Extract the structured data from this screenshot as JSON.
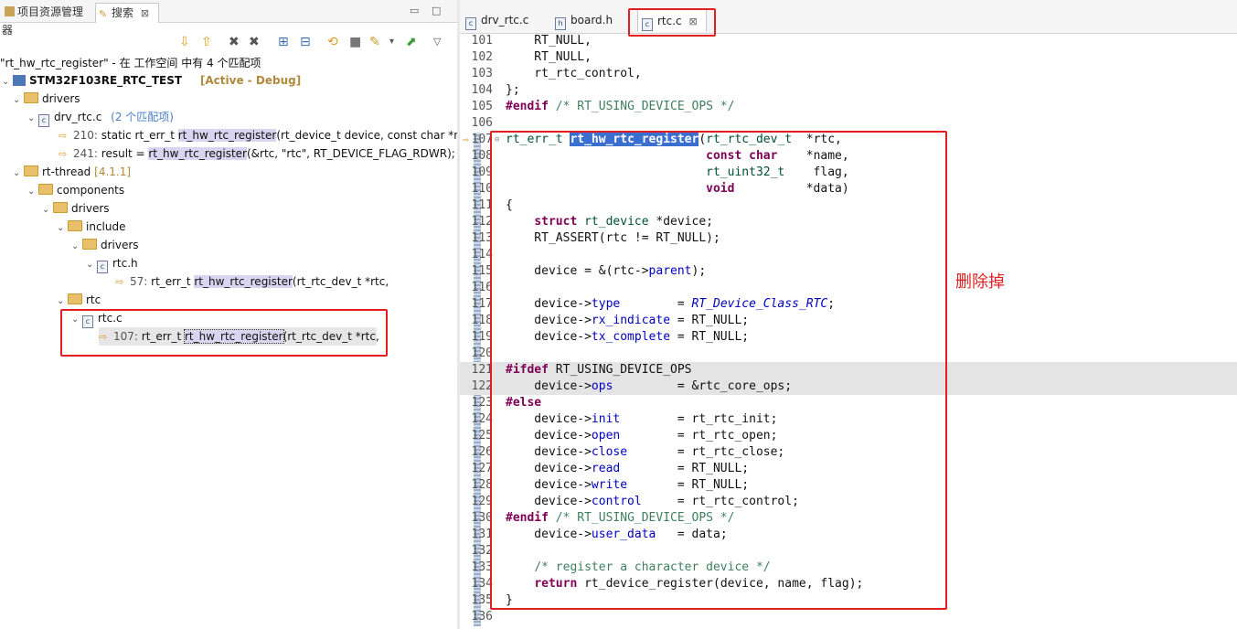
{
  "left_tabs": {
    "project_explorer": "项目资源管理器",
    "search": "搜索",
    "close": "⊠"
  },
  "search": {
    "summary": "\"rt_hw_rtc_register\" - 在 工作空间 中有 4 个匹配项"
  },
  "tree": {
    "project": "STM32F103RE_RTC_TEST",
    "project_status": "[Active - Debug]",
    "drivers": "drivers",
    "drv_file": "drv_rtc.c",
    "drv_file_count": "(2 个匹配项)",
    "match1_line": "210:",
    "match1_pre": "static rt_err_t ",
    "match1_hl": "rt_hw_rtc_register",
    "match1_post": "(rt_device_t device, const char *nam",
    "match2_line": "241:",
    "match2_pre": "result = ",
    "match2_hl": "rt_hw_rtc_register",
    "match2_post": "(&rtc, \"rtc\", RT_DEVICE_FLAG_RDWR);",
    "rt_thread": "rt-thread",
    "rt_thread_ver": "[4.1.1]",
    "components": "components",
    "drivers2": "drivers",
    "include": "include",
    "drivers3": "drivers",
    "rtc_h": "rtc.h",
    "match3_line": "57:",
    "match3_pre": "rt_err_t ",
    "match3_hl": "rt_hw_rtc_register",
    "match3_post": "(rt_rtc_dev_t  *rtc,",
    "rtc_folder": "rtc",
    "rtc_c": "rtc.c",
    "match4_line": "107:",
    "match4_pre": "rt_err_t ",
    "match4_hl": "rt_hw_rtc_register",
    "match4_post": "(rt_rtc_dev_t  *rtc,"
  },
  "editor_tabs": {
    "tab1": "drv_rtc.c",
    "tab2": "board.h",
    "tab3": "rtc.c",
    "close": "⊠"
  },
  "code": {
    "lines": [
      {
        "n": "101",
        "t": "    RT_NULL,"
      },
      {
        "n": "102",
        "t": "    RT_NULL,"
      },
      {
        "n": "103",
        "t": "    rt_rtc_control,"
      },
      {
        "n": "104",
        "t": "};"
      },
      {
        "n": "105",
        "t": "#endif /* RT_USING_DEVICE_OPS */"
      },
      {
        "n": "106",
        "t": ""
      },
      {
        "n": "107",
        "t": "rt_err_t rt_hw_rtc_register(rt_rtc_dev_t  *rtc,"
      },
      {
        "n": "108",
        "t": "                            const char    *name,"
      },
      {
        "n": "109",
        "t": "                            rt_uint32_t    flag,"
      },
      {
        "n": "110",
        "t": "                            void          *data)"
      },
      {
        "n": "111",
        "t": "{"
      },
      {
        "n": "112",
        "t": "    struct rt_device *device;"
      },
      {
        "n": "113",
        "t": "    RT_ASSERT(rtc != RT_NULL);"
      },
      {
        "n": "114",
        "t": ""
      },
      {
        "n": "115",
        "t": "    device = &(rtc->parent);"
      },
      {
        "n": "116",
        "t": ""
      },
      {
        "n": "117",
        "t": "    device->type        = RT_Device_Class_RTC;"
      },
      {
        "n": "118",
        "t": "    device->rx_indicate = RT_NULL;"
      },
      {
        "n": "119",
        "t": "    device->tx_complete = RT_NULL;"
      },
      {
        "n": "120",
        "t": ""
      },
      {
        "n": "121",
        "t": "#ifdef RT_USING_DEVICE_OPS"
      },
      {
        "n": "122",
        "t": "    device->ops         = &rtc_core_ops;"
      },
      {
        "n": "123",
        "t": "#else"
      },
      {
        "n": "124",
        "t": "    device->init        = rt_rtc_init;"
      },
      {
        "n": "125",
        "t": "    device->open        = rt_rtc_open;"
      },
      {
        "n": "126",
        "t": "    device->close       = rt_rtc_close;"
      },
      {
        "n": "127",
        "t": "    device->read        = RT_NULL;"
      },
      {
        "n": "128",
        "t": "    device->write       = RT_NULL;"
      },
      {
        "n": "129",
        "t": "    device->control     = rt_rtc_control;"
      },
      {
        "n": "130",
        "t": "#endif /* RT_USING_DEVICE_OPS */"
      },
      {
        "n": "131",
        "t": "    device->user_data   = data;"
      },
      {
        "n": "132",
        "t": ""
      },
      {
        "n": "133",
        "t": "    /* register a character device */"
      },
      {
        "n": "134",
        "t": "    return rt_device_register(device, name, flag);"
      },
      {
        "n": "135",
        "t": "}"
      },
      {
        "n": "136",
        "t": ""
      }
    ]
  },
  "annotation": "删除掉",
  "colors": {
    "annotation_red": "#e02020",
    "selection_blue": "#3a6fd0",
    "match_highlight": "#d9d4f0"
  }
}
